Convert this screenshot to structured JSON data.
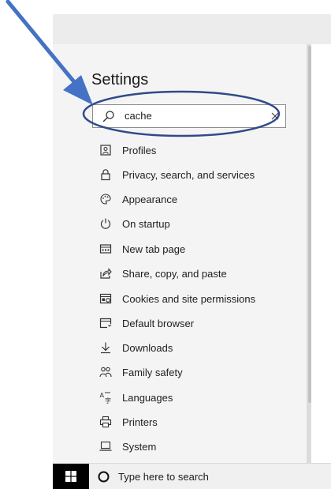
{
  "settings": {
    "title": "Settings",
    "search": {
      "value": "cache"
    },
    "menu": [
      {
        "label": "Profiles",
        "icon": "profile-icon"
      },
      {
        "label": "Privacy, search, and services",
        "icon": "lock-icon"
      },
      {
        "label": "Appearance",
        "icon": "palette-icon"
      },
      {
        "label": "On startup",
        "icon": "power-icon"
      },
      {
        "label": "New tab page",
        "icon": "new-tab-icon"
      },
      {
        "label": "Share, copy, and paste",
        "icon": "share-icon"
      },
      {
        "label": "Cookies and site permissions",
        "icon": "cookies-icon"
      },
      {
        "label": "Default browser",
        "icon": "browser-icon"
      },
      {
        "label": "Downloads",
        "icon": "download-icon"
      },
      {
        "label": "Family safety",
        "icon": "family-icon"
      },
      {
        "label": "Languages",
        "icon": "languages-icon"
      },
      {
        "label": "Printers",
        "icon": "printer-icon"
      },
      {
        "label": "System",
        "icon": "system-icon"
      }
    ]
  },
  "taskbar": {
    "search_placeholder": "Type here to search"
  },
  "colors": {
    "annotation": "#4472c4",
    "ellipse": "#2f4a8a"
  }
}
